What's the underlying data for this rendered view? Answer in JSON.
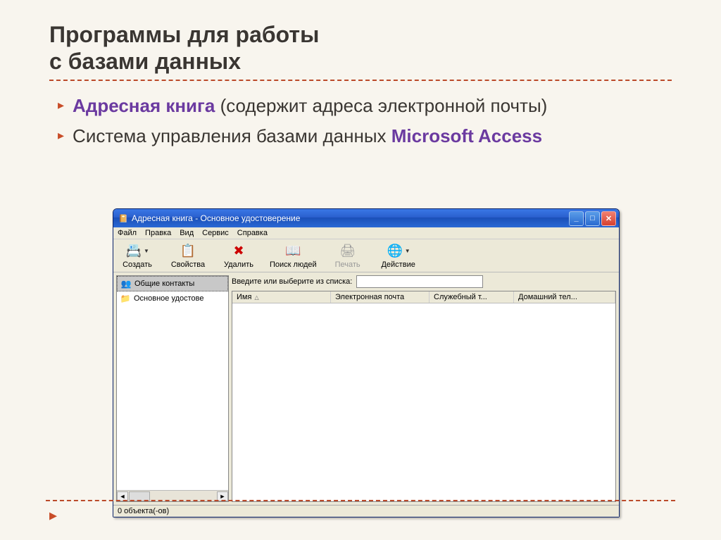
{
  "slide": {
    "title_line1": "Программы для работы",
    "title_line2": "с базами данных",
    "bullets": [
      {
        "emph": "Адресная книга",
        "rest": " (содержит адреса электронной почты)"
      },
      {
        "plain_before": "Система управления базами данных ",
        "emph": "Microsoft Access"
      }
    ]
  },
  "app": {
    "title": "Адресная книга - Основное удостоверение",
    "menu": [
      "Файл",
      "Правка",
      "Вид",
      "Сервис",
      "Справка"
    ],
    "toolbar": [
      {
        "label": "Создать",
        "icon": "📇",
        "dropdown": true
      },
      {
        "label": "Свойства",
        "icon": "📋"
      },
      {
        "label": "Удалить",
        "icon": "✖",
        "color": "#c00"
      },
      {
        "label": "Поиск людей",
        "icon": "📖"
      },
      {
        "label": "Печать",
        "icon": "🖨",
        "disabled": true
      },
      {
        "label": "Действие",
        "icon": "🌐",
        "dropdown": true
      }
    ],
    "tree": [
      {
        "label": "Общие контакты",
        "icon": "👥",
        "selected": true
      },
      {
        "label": "Основное удостове",
        "icon": "📁"
      }
    ],
    "search_label": "Введите или выберите из списка:",
    "search_value": "",
    "columns": {
      "name": "Имя",
      "email": "Электронная почта",
      "work": "Служебный т...",
      "home": "Домашний тел..."
    },
    "status": "0 объекта(-ов)"
  }
}
